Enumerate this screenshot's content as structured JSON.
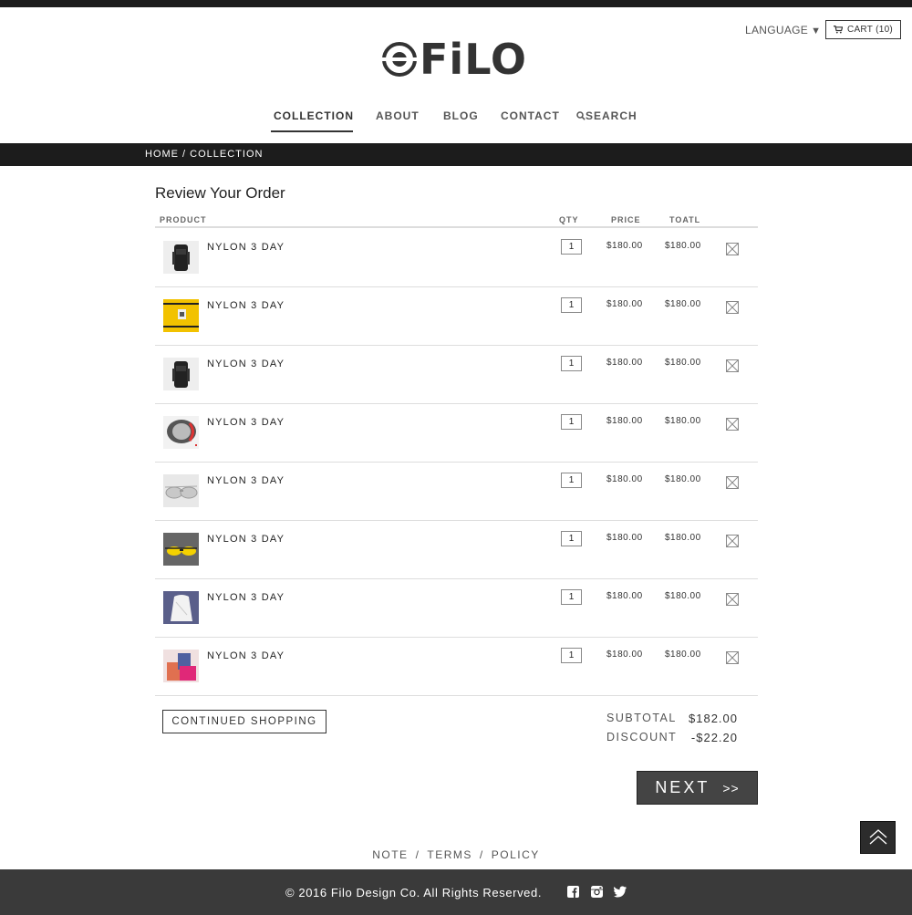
{
  "header": {
    "language_label": "LANGUAGE",
    "language_arrow": "▼",
    "cart_label": "CART (10)",
    "logo_text": "FiLO"
  },
  "nav": {
    "items": [
      "COLLECTION",
      "ABOUT",
      "BLOG",
      "CONTACT",
      "SEARCH"
    ],
    "active": "COLLECTION"
  },
  "breadcrumb": "HOME / COLLECTION",
  "order": {
    "title": "Review Your Order",
    "columns": {
      "product": "PRODUCT",
      "qty": "QTY",
      "price": "PRICE",
      "total": "TOATL"
    },
    "items": [
      {
        "name": "NYLON 3 DAY",
        "qty": "1",
        "price": "$180.00",
        "total": "$180.00",
        "image": "black-backpack"
      },
      {
        "name": "NYLON 3 DAY",
        "qty": "1",
        "price": "$180.00",
        "total": "$180.00",
        "image": "yellow-item"
      },
      {
        "name": "NYLON 3 DAY",
        "qty": "1",
        "price": "$180.00",
        "total": "$180.00",
        "image": "black-backpack"
      },
      {
        "name": "NYLON 3 DAY",
        "qty": "1",
        "price": "$180.00",
        "total": "$180.00",
        "image": "grey-bag"
      },
      {
        "name": "NYLON 3 DAY",
        "qty": "1",
        "price": "$180.00",
        "total": "$180.00",
        "image": "silver-sunglasses"
      },
      {
        "name": "NYLON 3 DAY",
        "qty": "1",
        "price": "$180.00",
        "total": "$180.00",
        "image": "yellow-sunglasses"
      },
      {
        "name": "NYLON 3 DAY",
        "qty": "1",
        "price": "$180.00",
        "total": "$180.00",
        "image": "white-backpack"
      },
      {
        "name": "NYLON 3 DAY",
        "qty": "1",
        "price": "$180.00",
        "total": "$180.00",
        "image": "pink-bags"
      }
    ],
    "continue_label": "CONTINUED SHOPPING",
    "subtotal_label": "SUBTOTAL",
    "subtotal_value": "$182.00",
    "discount_label": "DISCOUNT",
    "discount_value": "-$22.20",
    "next_label": "NEXT",
    "next_arrow": ">>"
  },
  "footer": {
    "links": [
      "NOTE",
      "TERMS",
      "POLICY"
    ],
    "separator": "/",
    "copyright": "© 2016 Filo Design Co. All Rights Reserved.",
    "social": [
      "facebook-icon",
      "instagram-icon",
      "twitter-icon"
    ]
  },
  "colors": {
    "dark": "#1c1c1c",
    "footer": "#3a3a3a",
    "button": "#444444",
    "text": "#333333"
  }
}
